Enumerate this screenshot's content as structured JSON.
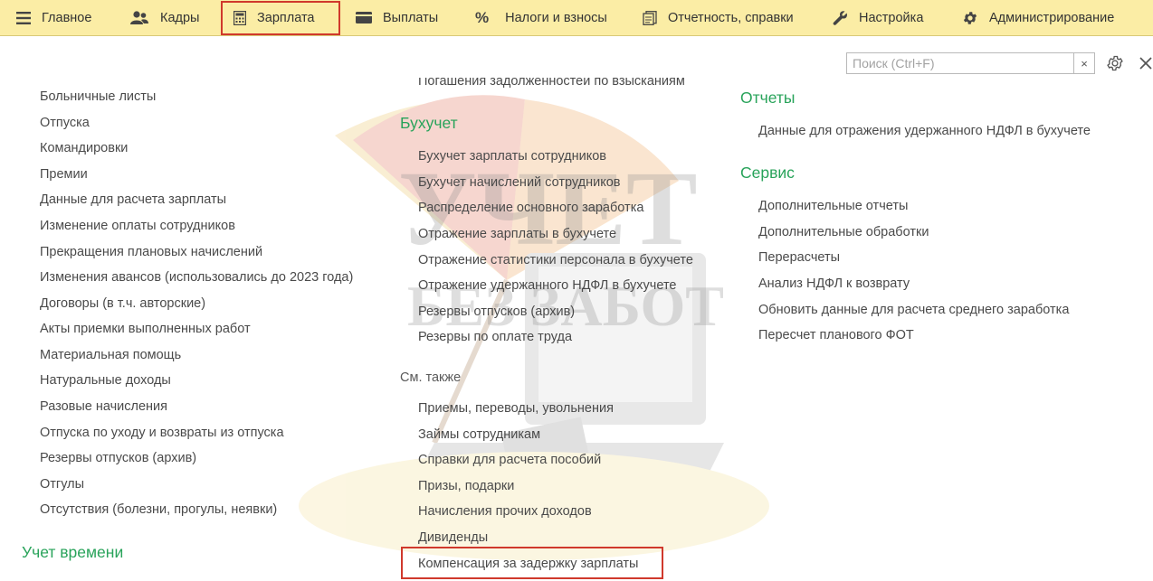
{
  "sections": [
    {
      "label": "Главное",
      "icon": "menu-icon"
    },
    {
      "label": "Кадры",
      "icon": "people-icon"
    },
    {
      "label": "Зарплата",
      "icon": "calculator-icon",
      "active": true
    },
    {
      "label": "Выплаты",
      "icon": "wallet-icon"
    },
    {
      "label": "Налоги и взносы",
      "icon": "percent-icon"
    },
    {
      "label": "Отчетность, справки",
      "icon": "documents-icon"
    },
    {
      "label": "Настройка",
      "icon": "wrench-icon"
    },
    {
      "label": "Администрирование",
      "icon": "gear-icon"
    }
  ],
  "search": {
    "placeholder": "Поиск (Ctrl+F)",
    "clear_label": "×"
  },
  "accent_color": "#28a35a",
  "highlight_color": "#d0392c",
  "col1": {
    "items": [
      "Больничные листы",
      "Отпуска",
      "Командировки",
      "Премии",
      "Данные для расчета зарплаты",
      "Изменение оплаты сотрудников",
      "Прекращения плановых начислений",
      "Изменения авансов (использовались до 2023 года)",
      "Договоры (в т.ч. авторские)",
      "Акты приемки выполненных работ",
      "Материальная помощь",
      "Натуральные доходы",
      "Разовые начисления",
      "Отпуска по уходу и возвраты из отпуска",
      "Резервы отпусков (архив)",
      "Отгулы",
      "Отсутствия (болезни, прогулы, неявки)"
    ],
    "time_group_title": "Учет времени"
  },
  "col2": {
    "clipped_item": "Погашения задолженностей по взысканиям",
    "accounting_title": "Бухучет",
    "accounting_items": [
      "Бухучет зарплаты сотрудников",
      "Бухучет начислений сотрудников",
      "Распределение основного заработка",
      "Отражение зарплаты в бухучете",
      "Отражение статистики персонала в бухучете",
      "Отражение удержанного НДФЛ в бухучете",
      "Резервы отпусков (архив)",
      "Резервы по оплате труда"
    ],
    "see_also_title": "См. также",
    "see_also_items": [
      "Приемы, переводы, увольнения",
      "Займы сотрудникам",
      "Справки для расчета пособий",
      "Призы, подарки",
      "Начисления прочих доходов",
      "Дивиденды",
      "Компенсация за задержку зарплаты"
    ]
  },
  "col3": {
    "reports_title": "Отчеты",
    "reports_items": [
      "Данные для отражения удержанного НДФЛ в бухучете"
    ],
    "service_title": "Сервис",
    "service_items": [
      "Дополнительные отчеты",
      "Дополнительные обработки",
      "Перерасчеты",
      "Анализ НДФЛ к возврату",
      "Обновить данные для расчета среднего заработка",
      "Пересчет планового ФОТ"
    ]
  },
  "watermark": {
    "line1": "УЧЕТ",
    "line2": "БЕЗ ЗАБОТ"
  }
}
